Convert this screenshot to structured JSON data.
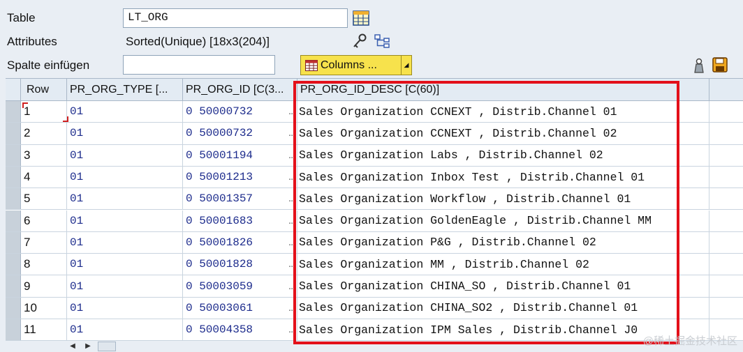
{
  "form": {
    "table_label": "Table",
    "table_value": "LT_ORG",
    "attributes_label": "Attributes",
    "attributes_value": "Sorted(Unique) [18x3(204)]",
    "insert_column_label": "Spalte einfügen",
    "insert_column_value": "",
    "columns_button": "Columns ..."
  },
  "grid": {
    "headers": [
      "Row",
      "PR_ORG_TYPE [...",
      "PR_ORG_ID [C(3...",
      "PR_ORG_ID_DESC [C(60)]"
    ],
    "rows": [
      {
        "row": "1",
        "type": "01",
        "id": "0 50000732",
        "desc": "Sales Organization CCNEXT , Distrib.Channel 01"
      },
      {
        "row": "2",
        "type": "01",
        "id": "0 50000732",
        "desc": "Sales Organization CCNEXT , Distrib.Channel 02"
      },
      {
        "row": "3",
        "type": "01",
        "id": "0 50001194",
        "desc": "Sales Organization Labs , Distrib.Channel 02"
      },
      {
        "row": "4",
        "type": "01",
        "id": "0 50001213",
        "desc": "Sales Organization Inbox Test , Distrib.Channel 01"
      },
      {
        "row": "5",
        "type": "01",
        "id": "0 50001357",
        "desc": "Sales Organization Workflow , Distrib.Channel 01"
      },
      {
        "row": "6",
        "type": "01",
        "id": "0 50001683",
        "desc": "Sales Organization GoldenEagle , Distrib.Channel MM"
      },
      {
        "row": "7",
        "type": "01",
        "id": "0 50001826",
        "desc": "Sales Organization P&G , Distrib.Channel 02"
      },
      {
        "row": "8",
        "type": "01",
        "id": "0 50001828",
        "desc": "Sales Organization MM , Distrib.Channel 02"
      },
      {
        "row": "9",
        "type": "01",
        "id": "0 50003059",
        "desc": "Sales Organization CHINA_SO , Distrib.Channel 01"
      },
      {
        "row": "10",
        "type": "01",
        "id": "0 50003061",
        "desc": "Sales Organization CHINA_SO2 , Distrib.Channel 01"
      },
      {
        "row": "11",
        "type": "01",
        "id": "0 50004358",
        "desc": "Sales Organization IPM Sales , Distrib.Channel J0"
      }
    ]
  },
  "watermark": "@稀土掘金技术社区",
  "colors": {
    "highlight": "#e3101a",
    "columns_button": "#f7e24c",
    "id_text": "#1c2b8c"
  },
  "icons": [
    "table-view-icon",
    "key-icon",
    "hierarchy-icon",
    "dropdown-arrow-icon",
    "weight-icon",
    "save-icon",
    "scroll-left-icon",
    "scroll-right-icon"
  ]
}
